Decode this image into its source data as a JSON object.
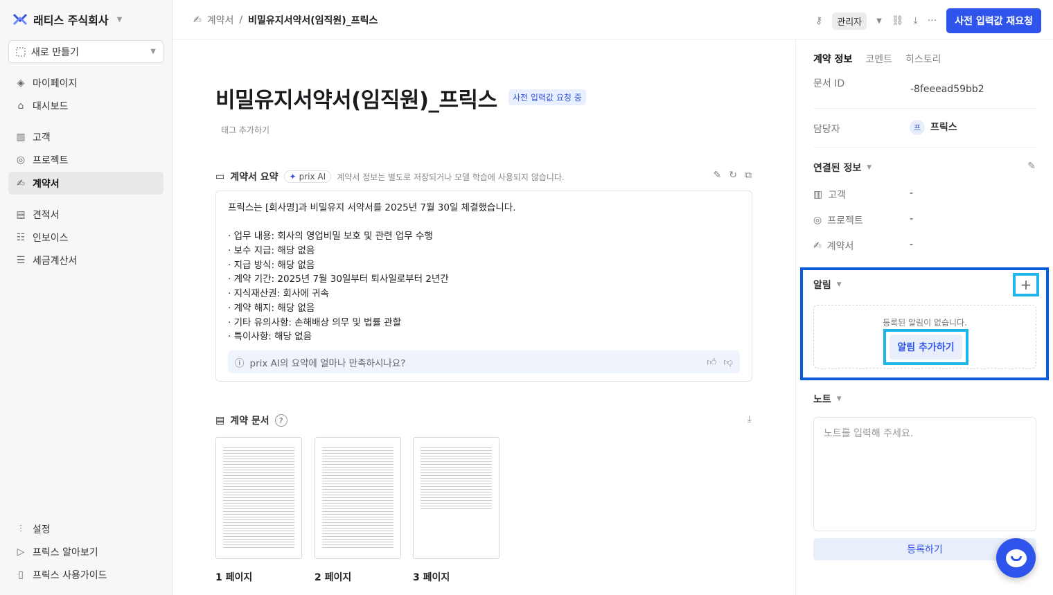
{
  "sidebar": {
    "org_name": "래티스 주식회사",
    "new_label": "새로 만들기",
    "nav1": [
      {
        "label": "마이페이지",
        "icon": "diamond-icon"
      },
      {
        "label": "대시보드",
        "icon": "home-icon"
      }
    ],
    "nav2": [
      {
        "label": "고객",
        "icon": "building-icon"
      },
      {
        "label": "프로젝트",
        "icon": "target-icon"
      },
      {
        "label": "계약서",
        "icon": "signature-icon"
      }
    ],
    "nav3": [
      {
        "label": "견적서",
        "icon": "document-icon"
      },
      {
        "label": "인보이스",
        "icon": "invoice-icon"
      },
      {
        "label": "세금계산서",
        "icon": "receipt-icon"
      }
    ],
    "bottom": [
      {
        "label": "설정",
        "icon": "sliders-icon"
      },
      {
        "label": "프릭스 알아보기",
        "icon": "fast-forward-icon"
      },
      {
        "label": "프릭스 사용가이드",
        "icon": "book-icon"
      }
    ]
  },
  "topbar": {
    "crumb_parent": "계약서",
    "crumb_current": "비밀유지서약서(임직원)_프릭스",
    "role": "관리자",
    "primary_button": "사전 입력값 재요청"
  },
  "main": {
    "title": "비밀유지서약서(임직원)_프릭스",
    "status_badge": "사전 입력값 요청 중",
    "tag_add": "태그 추가하기",
    "summary": {
      "heading": "계약서 요약",
      "ai_label": "prix AI",
      "note": "계약서 정보는 별도로 저장되거나 모델 학습에 사용되지 않습니다.",
      "lines": [
        "프릭스는 [회사명]과 비밀유지 서약서를 2025년 7월 30일 체결했습니다.",
        "",
        "· 업무 내용: 회사의 영업비밀 보호 및 관련 업무 수행",
        "· 보수 지급: 해당 없음",
        "· 지급 방식: 해당 없음",
        "· 계약 기간: 2025년 7월 30일부터 퇴사일로부터 2년간",
        "· 지식재산권: 회사에 귀속",
        "· 계약 해지: 해당 없음",
        "· 기타 유의사항: 손해배상 의무 및 법률 관할",
        "· 특이사항: 해당 없음"
      ],
      "feedback": "prix AI의 요약에 얼마나 만족하시나요?"
    },
    "docs": {
      "heading": "계약 문서",
      "help": "?",
      "pages": [
        "1 페이지",
        "2 페이지",
        "3 페이지"
      ]
    }
  },
  "right": {
    "tabs": [
      "계약 정보",
      "코멘트",
      "히스토리"
    ],
    "doc_id_label": "문서 ID",
    "doc_id_visible_line": "-8feeead59bb2",
    "owner_label": "담당자",
    "owner_avatar": "프",
    "owner_name": "프릭스",
    "linked_heading": "연결된 정보",
    "linked": [
      {
        "label": "고객",
        "value": "-",
        "icon": "building-icon"
      },
      {
        "label": "프로젝트",
        "value": "-",
        "icon": "target-icon"
      },
      {
        "label": "계약서",
        "value": "-",
        "icon": "signature-icon"
      }
    ],
    "alarm_heading": "알림",
    "alarm_empty": "등록된 알림이 없습니다.",
    "alarm_add": "알림 추가하기",
    "note_heading": "노트",
    "note_placeholder": "노트를 입력해 주세요.",
    "submit": "등록하기"
  },
  "colors": {
    "accent": "#2f54eb",
    "highlight_frame": "#0a5bd8",
    "highlight_inner": "#20b6ea"
  }
}
